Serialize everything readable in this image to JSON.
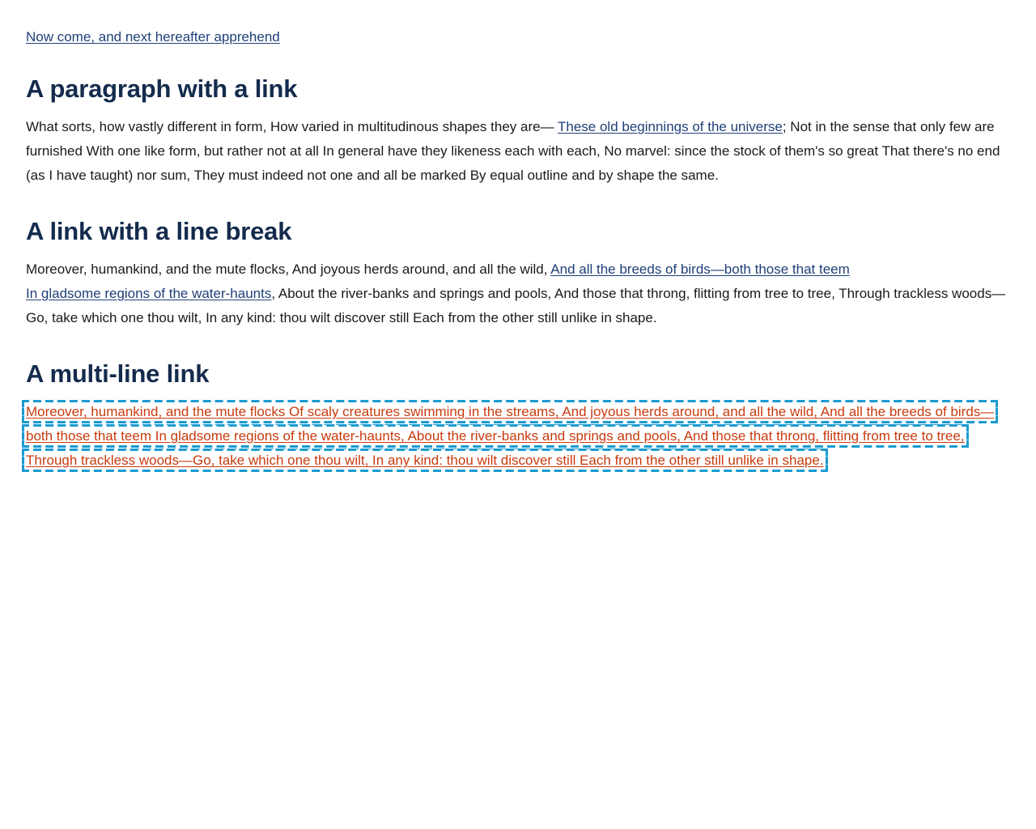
{
  "top_link": "Now come, and next hereafter apprehend",
  "sections": [
    {
      "heading": "A paragraph with a link",
      "text_before": "What sorts, how vastly different in form, How varied in multitudinous shapes they are— ",
      "link": "These old beginnings of the universe",
      "text_after": "; Not in the sense that only few are furnished With one like form, but rather not at all In general have they likeness each with each, No marvel: since the stock of them's so great That there's no end (as I have taught) nor sum, They must indeed not one and all be marked By equal outline and by shape the same."
    },
    {
      "heading": "A link with a line break",
      "text_before": "Moreover, humankind, and the mute flocks, And joyous herds around, and all the wild, ",
      "link_line1": "And all the breeds of birds—both those that teem",
      "link_line2": "In gladsome regions of the water-haunts",
      "text_after": ", About the river-banks and springs and pools, And those that throng, flitting from tree to tree, Through trackless woods—Go, take which one thou wilt, In any kind: thou wilt discover still Each from the other still unlike in shape."
    },
    {
      "heading": "A multi-line link",
      "link": "Moreover, humankind, and the mute flocks Of scaly creatures swimming in the streams, And joyous herds around, and all the wild, And all the breeds of birds—both those that teem In gladsome regions of the water-haunts, About the river-banks and springs and pools, And those that throng, flitting from tree to tree, Through trackless woods—Go, take which one thou wilt, In any kind: thou wilt discover still Each from the other still unlike in shape."
    }
  ],
  "colors": {
    "link": "#1f3f78",
    "heading": "#142b4d",
    "focused_link": "#c83b0f",
    "focus_outline": "#1b9bd1"
  }
}
